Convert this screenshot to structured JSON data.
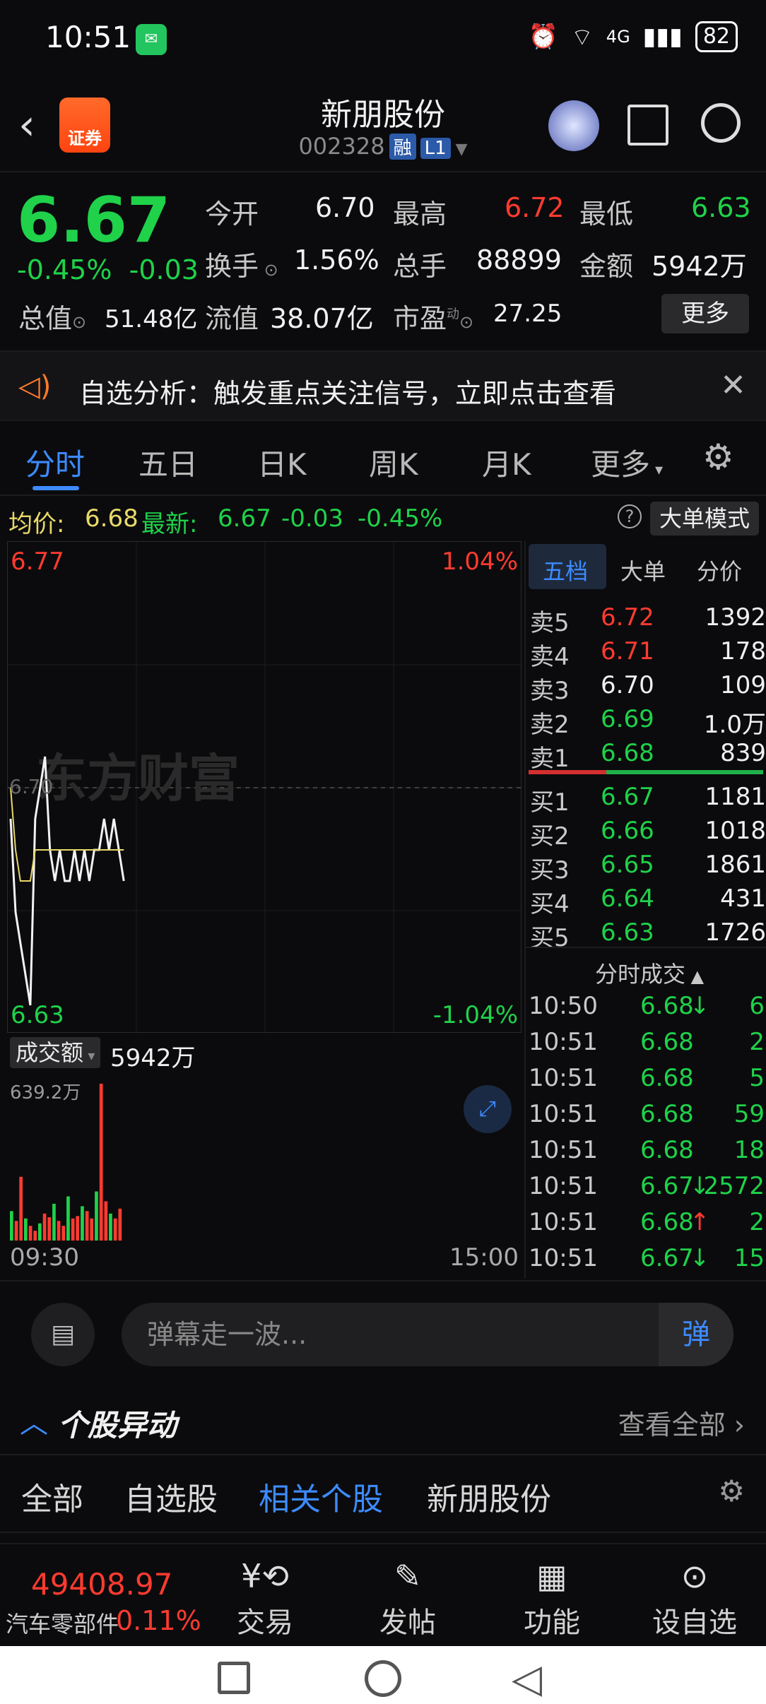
{
  "status_bar": {
    "time": "10:51",
    "signal": "4G",
    "battery": "82"
  },
  "header": {
    "title": "新朋股份",
    "code": "002328",
    "tag_margin": "融",
    "tag_level": "L1",
    "logo_text": "证券"
  },
  "quote": {
    "price": "6.67",
    "change_pct": "-0.45%",
    "change": "-0.03",
    "open_label": "今开",
    "open": "6.70",
    "high_label": "最高",
    "high": "6.72",
    "low_label": "最低",
    "low": "6.63",
    "turnover_label": "换手",
    "turnover": "1.56%",
    "volume_label": "总手",
    "volume": "88899",
    "amount_label": "金额",
    "amount": "5942万",
    "mcap_label": "总值",
    "mcap": "51.48亿",
    "float_label": "流值",
    "float_mcap": "38.07亿",
    "pe_label": "市盈",
    "pe_sup": "动",
    "pe": "27.25",
    "more": "更多"
  },
  "notice": {
    "text": "自选分析：触发重点关注信号，立即点击查看"
  },
  "tabs": [
    "分时",
    "五日",
    "日K",
    "周K",
    "月K",
    "更多"
  ],
  "infobar": {
    "avg_label": "均价:",
    "avg": "6.68",
    "latest_label": "最新:",
    "latest": "6.67",
    "chg": "-0.03",
    "pct": "-0.45%",
    "big_mode": "大单模式"
  },
  "chart": {
    "price_top": "6.77",
    "price_bottom": "6.63",
    "pct_top": "1.04%",
    "pct_bottom": "-1.04%",
    "ref_price": "6.70",
    "watermark": "东方财富",
    "vol_label": "成交额",
    "vol_total": "5942万",
    "vol_max": "639.2万",
    "time_start": "09:30",
    "time_end": "15:00"
  },
  "chart_data": {
    "type": "line",
    "series": [
      {
        "name": "price",
        "values": [
          6.69,
          6.66,
          6.65,
          6.64,
          6.63,
          6.69,
          6.7,
          6.71,
          6.68,
          6.67,
          6.68,
          6.67,
          6.67,
          6.68,
          6.67,
          6.68,
          6.67,
          6.68,
          6.68,
          6.69,
          6.68,
          6.69,
          6.68,
          6.67
        ]
      },
      {
        "name": "avg",
        "values": [
          6.7,
          6.68,
          6.67,
          6.67,
          6.67,
          6.68,
          6.68,
          6.68,
          6.68,
          6.68,
          6.68,
          6.68,
          6.68,
          6.68,
          6.68,
          6.68,
          6.68,
          6.68,
          6.68,
          6.68,
          6.68,
          6.68,
          6.68,
          6.68
        ]
      }
    ],
    "ylim": [
      6.63,
      6.77
    ],
    "ref": 6.7,
    "volume": [
      120,
      80,
      260,
      90,
      60,
      40,
      70,
      110,
      95,
      150,
      80,
      60,
      180,
      90,
      100,
      140,
      120,
      90,
      200,
      639,
      160,
      110,
      90,
      130
    ]
  },
  "order_book": {
    "tabs": [
      "五档",
      "大单",
      "分价"
    ],
    "asks": [
      {
        "label": "卖5",
        "price": "6.72",
        "vol": "1392"
      },
      {
        "label": "卖4",
        "price": "6.71",
        "vol": "178"
      },
      {
        "label": "卖3",
        "price": "6.70",
        "vol": "109"
      },
      {
        "label": "卖2",
        "price": "6.69",
        "vol": "1.0万"
      },
      {
        "label": "卖1",
        "price": "6.68",
        "vol": "839"
      }
    ],
    "bids": [
      {
        "label": "买1",
        "price": "6.67",
        "vol": "1181"
      },
      {
        "label": "买2",
        "price": "6.66",
        "vol": "1018"
      },
      {
        "label": "买3",
        "price": "6.65",
        "vol": "1861"
      },
      {
        "label": "买4",
        "price": "6.64",
        "vol": "431"
      },
      {
        "label": "买5",
        "price": "6.63",
        "vol": "1726"
      }
    ],
    "ticks_title": "分时成交",
    "ticks": [
      {
        "time": "10:50",
        "price": "6.68",
        "dir": "↓",
        "vol": "6"
      },
      {
        "time": "10:51",
        "price": "6.68",
        "dir": "",
        "vol": "2"
      },
      {
        "time": "10:51",
        "price": "6.68",
        "dir": "",
        "vol": "5"
      },
      {
        "time": "10:51",
        "price": "6.68",
        "dir": "",
        "vol": "59"
      },
      {
        "time": "10:51",
        "price": "6.68",
        "dir": "",
        "vol": "18"
      },
      {
        "time": "10:51",
        "price": "6.67",
        "dir": "↓",
        "vol": "2572"
      },
      {
        "time": "10:51",
        "price": "6.68",
        "dir": "↑",
        "vol": "2"
      },
      {
        "time": "10:51",
        "price": "6.67",
        "dir": "↓",
        "vol": "15"
      }
    ]
  },
  "danmu": {
    "placeholder": "弹幕走一波...",
    "button": "弹"
  },
  "alerts": {
    "title": "个股异动",
    "view_all": "查看全部"
  },
  "subtabs": [
    "全部",
    "自选股",
    "相关个股",
    "新朋股份"
  ],
  "bottom": {
    "index_value": "49408.97",
    "index_name": "汽车零部件",
    "index_pct": "0.11%",
    "nav": [
      "交易",
      "发帖",
      "功能",
      "设自选"
    ]
  },
  "colors": {
    "up": "#ff3b30",
    "down": "#1fd24a",
    "accent": "#3d8bff",
    "avg_line": "#e8d96a"
  }
}
